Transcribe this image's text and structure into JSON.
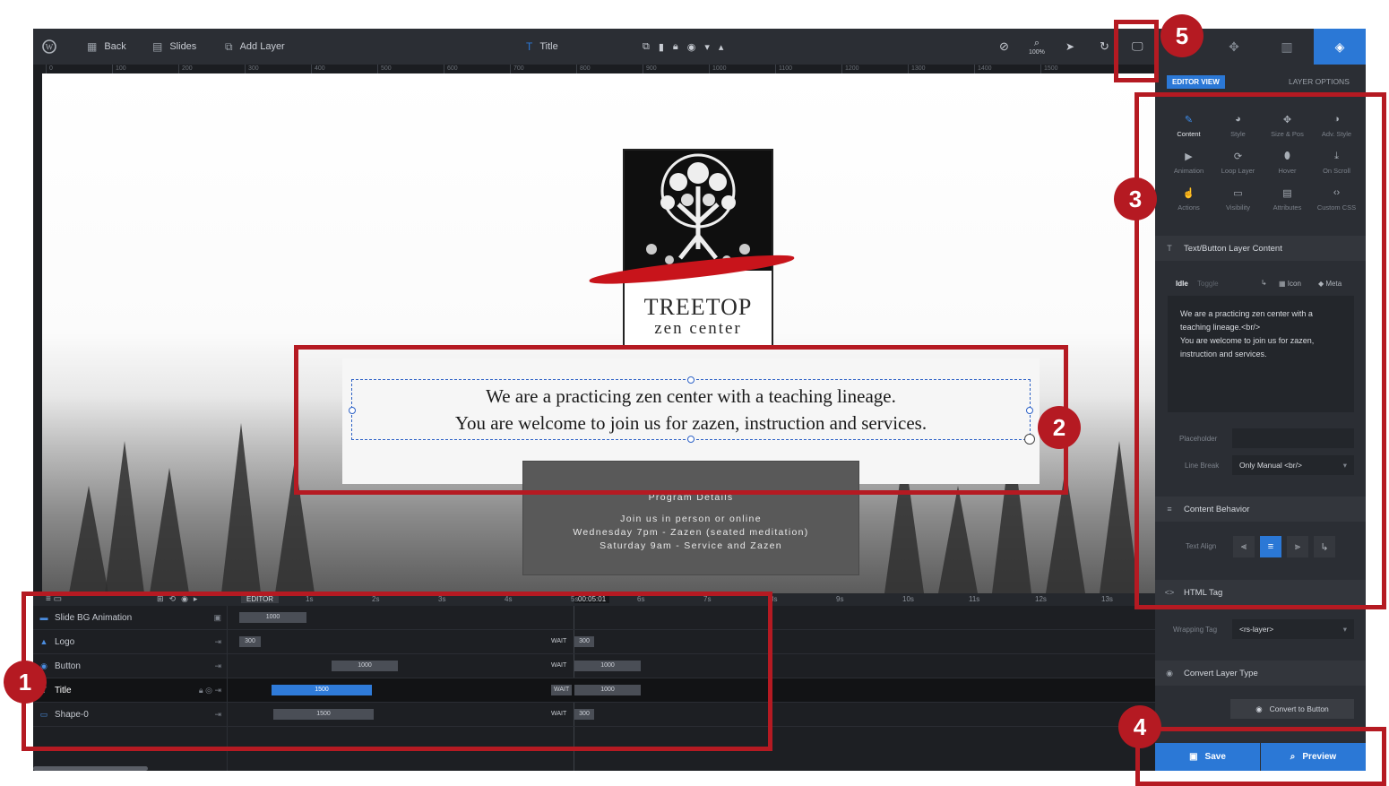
{
  "topbar": {
    "wp_icon": "wordpress-icon",
    "back_label": "Back",
    "slides_label": "Slides",
    "add_layer_label": "Add Layer",
    "layer_type_icon": "T",
    "layer_name": "Title",
    "zoom": "100%"
  },
  "ruler_ticks": [
    "0",
    "100",
    "200",
    "300",
    "400",
    "500",
    "600",
    "700",
    "800",
    "900",
    "1000",
    "1100",
    "1200",
    "1300",
    "1400",
    "1500"
  ],
  "canvas": {
    "logo_name": "TREETOP",
    "logo_sub": "zen center",
    "title_line1": "We are a practicing zen center with a teaching lineage.",
    "title_line2": "You are welcome to join us for zazen, instruction and services.",
    "program_title": "Program Details",
    "program_line1": "Join us in person or online",
    "program_line2": "Wednesday 7pm - Zazen (seated meditation)",
    "program_line3": "Saturday 9am - Service and Zazen"
  },
  "timeline": {
    "editor_label": "EDITOR",
    "time_marker": "00:05:01",
    "second_ticks": [
      "1s",
      "2s",
      "3s",
      "4s",
      "5s",
      "6s",
      "7s",
      "8s",
      "9s",
      "10s",
      "11s",
      "12s",
      "13s"
    ],
    "rows": [
      {
        "name": "Slide BG Animation",
        "bar1": "1000",
        "wait": "",
        "bar2": ""
      },
      {
        "name": "Logo",
        "bar1": "300",
        "wait": "WAIT",
        "bar2": "300"
      },
      {
        "name": "Button",
        "bar1": "1000",
        "wait": "WAIT",
        "bar2": "1000"
      },
      {
        "name": "Title",
        "bar1": "1500",
        "wait": "WAIT",
        "bar2": "1000"
      },
      {
        "name": "Shape-0",
        "bar1": "1500",
        "wait": "WAIT",
        "bar2": "300"
      }
    ]
  },
  "rpanel": {
    "editor_view": "EDITOR VIEW",
    "layer_options": "LAYER OPTIONS",
    "options": [
      {
        "label": "Content",
        "icon": "pencil-icon"
      },
      {
        "label": "Style",
        "icon": "palette-icon"
      },
      {
        "label": "Size & Pos",
        "icon": "move-icon"
      },
      {
        "label": "Adv. Style",
        "icon": "contrast-icon"
      },
      {
        "label": "Animation",
        "icon": "play-icon"
      },
      {
        "label": "Loop Layer",
        "icon": "loop-icon"
      },
      {
        "label": "Hover",
        "icon": "mouse-icon"
      },
      {
        "label": "On Scroll",
        "icon": "scroll-icon"
      },
      {
        "label": "Actions",
        "icon": "hand-icon"
      },
      {
        "label": "Visibility",
        "icon": "monitor-icon"
      },
      {
        "label": "Attributes",
        "icon": "file-icon"
      },
      {
        "label": "Custom CSS",
        "icon": "code-icon"
      }
    ],
    "section_content": "Text/Button Layer Content",
    "idle_label": "Idle",
    "toggle_label": "Toggle",
    "icon_label": "Icon",
    "meta_label": "Meta",
    "content_line1": "We are a practicing zen center with a teaching lineage.<br/>",
    "content_line2": "You are welcome to join us for zazen, instruction and services.",
    "placeholder_label": "Placeholder",
    "linebreak_label": "Line Break",
    "linebreak_value": "Only Manual <br/>",
    "section_behavior": "Content Behavior",
    "text_align_label": "Text Align",
    "section_html": "HTML Tag",
    "wrapping_label": "Wrapping Tag",
    "wrapping_value": "<rs-layer>",
    "section_convert": "Convert Layer Type",
    "convert_button": "Convert to Button",
    "save_label": "Save",
    "preview_label": "Preview"
  },
  "annotations": [
    "1",
    "2",
    "3",
    "4",
    "5"
  ],
  "colors": {
    "accent": "#2b78d6",
    "highlight": "#b51a22"
  }
}
